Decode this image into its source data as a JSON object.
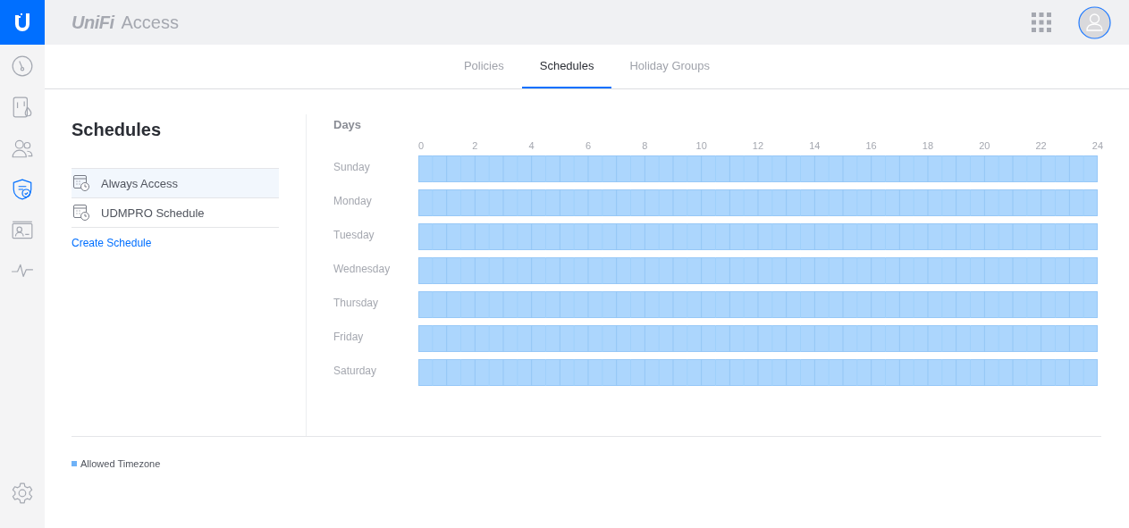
{
  "app": {
    "title_brand": "UniFi",
    "title_product": "Access"
  },
  "sidebar": {
    "items": [
      {
        "kind": "dashboard",
        "selected": false
      },
      {
        "kind": "doors",
        "selected": false
      },
      {
        "kind": "users",
        "selected": false
      },
      {
        "kind": "policies",
        "selected": true
      },
      {
        "kind": "cards",
        "selected": false
      },
      {
        "kind": "activity",
        "selected": false
      }
    ],
    "bottom": [
      {
        "kind": "settings",
        "selected": false
      }
    ]
  },
  "tabs": [
    {
      "label": "Policies",
      "selected": false
    },
    {
      "label": "Schedules",
      "selected": true
    },
    {
      "label": "Holiday Groups",
      "selected": false
    }
  ],
  "schedules": {
    "title": "Schedules",
    "items": [
      {
        "label": "Always Access",
        "selected": true
      },
      {
        "label": "UDMPRO Schedule",
        "selected": false
      }
    ],
    "create_link": "Create Schedule"
  },
  "days_grid": {
    "title": "Days",
    "hour_ticks": [
      "0",
      "2",
      "4",
      "6",
      "8",
      "10",
      "12",
      "14",
      "16",
      "18",
      "20",
      "22",
      "24"
    ],
    "days": [
      {
        "label": "Sunday",
        "level": 1
      },
      {
        "label": "Monday",
        "level": 1
      },
      {
        "label": "Tuesday",
        "level": 1
      },
      {
        "label": "Wednesday",
        "level": 1
      },
      {
        "label": "Thursday",
        "level": 1
      },
      {
        "label": "Friday",
        "level": 1
      },
      {
        "label": "Saturday",
        "level": 1
      }
    ]
  },
  "legend": [
    {
      "label": "Allowed Timezone",
      "color": "#6fb2f7"
    }
  ]
}
